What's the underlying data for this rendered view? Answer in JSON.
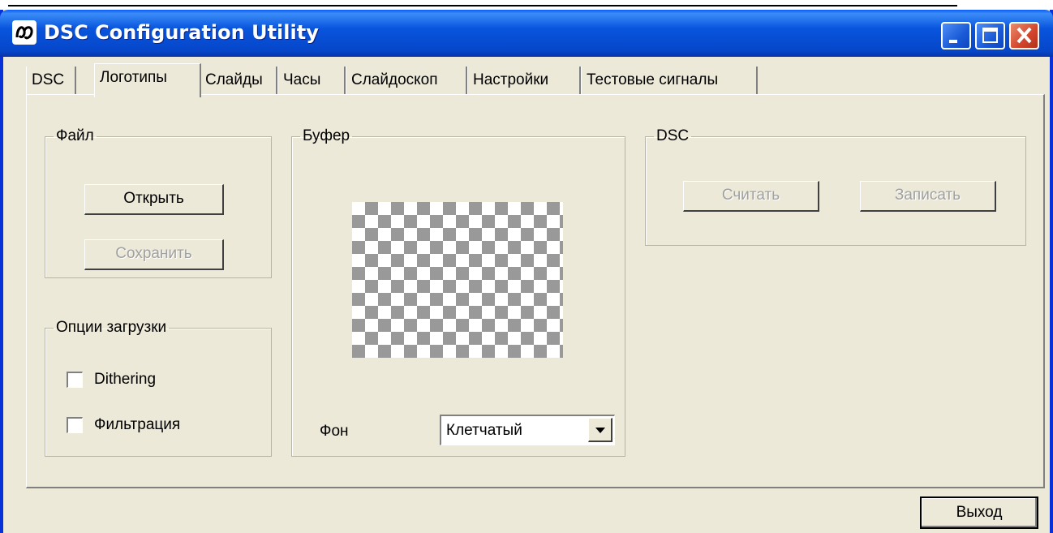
{
  "window": {
    "title": "DSC Configuration Utility",
    "icon": "app-logo-icon"
  },
  "tabs": [
    {
      "label": "DSC",
      "active": false
    },
    {
      "label": "Логотипы",
      "active": true
    },
    {
      "label": "Слайды",
      "active": false
    },
    {
      "label": "Часы",
      "active": false
    },
    {
      "label": "Слайдоскоп",
      "active": false
    },
    {
      "label": "Настройки",
      "active": false
    },
    {
      "label": "Тестовые сигналы",
      "active": false
    }
  ],
  "file_group": {
    "title": "Файл",
    "open_label": "Открыть",
    "save_label": "Сохранить"
  },
  "load_options": {
    "title": "Опции загрузки",
    "dithering_label": "Dithering",
    "filter_label": "Фильтрация"
  },
  "buffer_group": {
    "title": "Буфер",
    "background_label": "Фон",
    "background_value": "Клетчатый"
  },
  "dsc_group": {
    "title": "DSC",
    "read_label": "Считать",
    "write_label": "Записать"
  },
  "footer": {
    "exit_label": "Выход"
  }
}
